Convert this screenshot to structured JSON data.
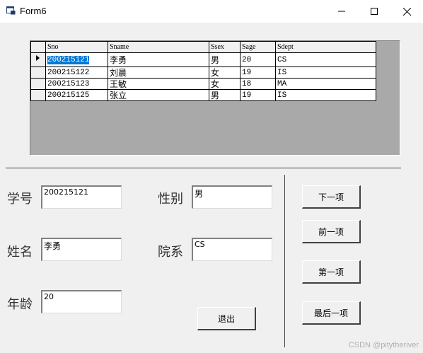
{
  "window": {
    "title": "Form6"
  },
  "grid": {
    "columns": [
      "Sno",
      "Sname",
      "Ssex",
      "Sage",
      "Sdept"
    ],
    "rows": [
      [
        "200215121",
        "李勇",
        "男",
        "20",
        "CS"
      ],
      [
        "200215122",
        "刘晨",
        "女",
        "19",
        "IS"
      ],
      [
        "200215123",
        "王敏",
        "女",
        "18",
        "MA"
      ],
      [
        "200215125",
        "张立",
        "男",
        "19",
        "IS"
      ]
    ]
  },
  "form": {
    "sno_label": "学号",
    "sno_value": "200215121",
    "sname_label": "姓名",
    "sname_value": "李勇",
    "sage_label": "年龄",
    "sage_value": "20",
    "ssex_label": "性别",
    "ssex_value": "男",
    "sdept_label": "院系",
    "sdept_value": "CS"
  },
  "buttons": {
    "next": "下一项",
    "prev": "前一项",
    "first": "第一项",
    "last": "最后一项",
    "exit": "退出"
  },
  "watermark": "CSDN @pitytheriver",
  "colors": {
    "selection": "#0078d7",
    "background": "#f0f0f0"
  }
}
